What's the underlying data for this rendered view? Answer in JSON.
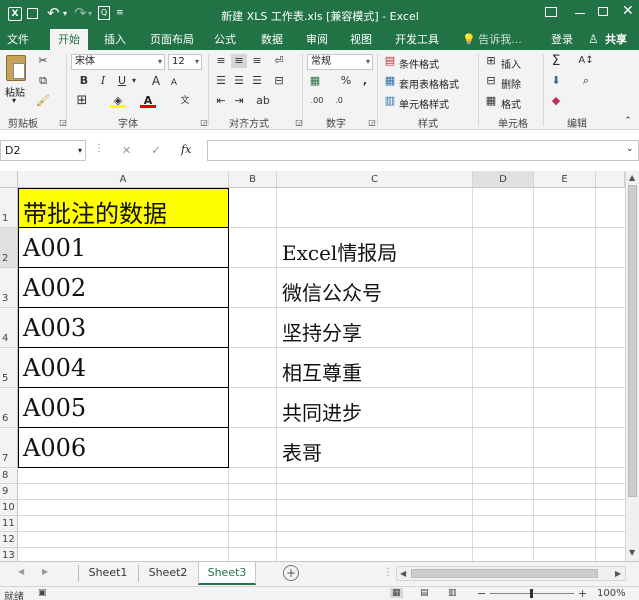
{
  "window": {
    "title": "新建 XLS 工作表.xls  [兼容模式] - Excel",
    "undo_icon": "undo-icon",
    "redo_icon": "redo-icon",
    "qat_icon": "preview-icon"
  },
  "ribbon_tabs": [
    "文件",
    "开始",
    "插入",
    "页面布局",
    "公式",
    "数据",
    "审阅",
    "视图",
    "开发工具"
  ],
  "active_tab": "开始",
  "tell_me": "告诉我...",
  "account": {
    "signin": "登录",
    "share": "共享"
  },
  "clipboard": {
    "paste": "粘贴",
    "group": "剪贴板"
  },
  "font": {
    "name": "宋体",
    "size": "12",
    "bold": "B",
    "italic": "I",
    "underline": "U",
    "grow": "A",
    "shrink": "A",
    "group": "字体"
  },
  "alignment": {
    "group": "对齐方式"
  },
  "number": {
    "format": "常规",
    "percent": "%",
    "comma": ",",
    "group": "数字"
  },
  "styles": {
    "conditional": "条件格式",
    "table": "套用表格格式",
    "cell": "单元格样式",
    "group": "样式"
  },
  "cells": {
    "insert": "插入",
    "delete": "删除",
    "format": "格式",
    "group": "单元格"
  },
  "editing": {
    "group": "编辑"
  },
  "formula_bar": {
    "name_box": "D2",
    "cancel": "✕",
    "enter": "✓",
    "fx": "fx",
    "formula": ""
  },
  "columns": [
    "A",
    "B",
    "C",
    "D",
    "E"
  ],
  "rows": [
    "1",
    "2",
    "3",
    "4",
    "5",
    "6",
    "7",
    "8",
    "9",
    "10",
    "11",
    "12",
    "13"
  ],
  "cells_data": {
    "A1": "带批注的数据",
    "A2": "A001",
    "A3": "A002",
    "A4": "A003",
    "A5": "A004",
    "A6": "A005",
    "A7": "A006",
    "C2": "Excel情报局",
    "C3": "微信公众号",
    "C4": "坚持分享",
    "C5": "相互尊重",
    "C6": "共同进步",
    "C7": "表哥"
  },
  "sheets": [
    "Sheet1",
    "Sheet2",
    "Sheet3"
  ],
  "active_sheet": "Sheet3",
  "status": {
    "ready": "就绪",
    "zoom": "100%"
  },
  "colors": {
    "excel_green": "#217346",
    "header_fill": "#ffff00"
  }
}
